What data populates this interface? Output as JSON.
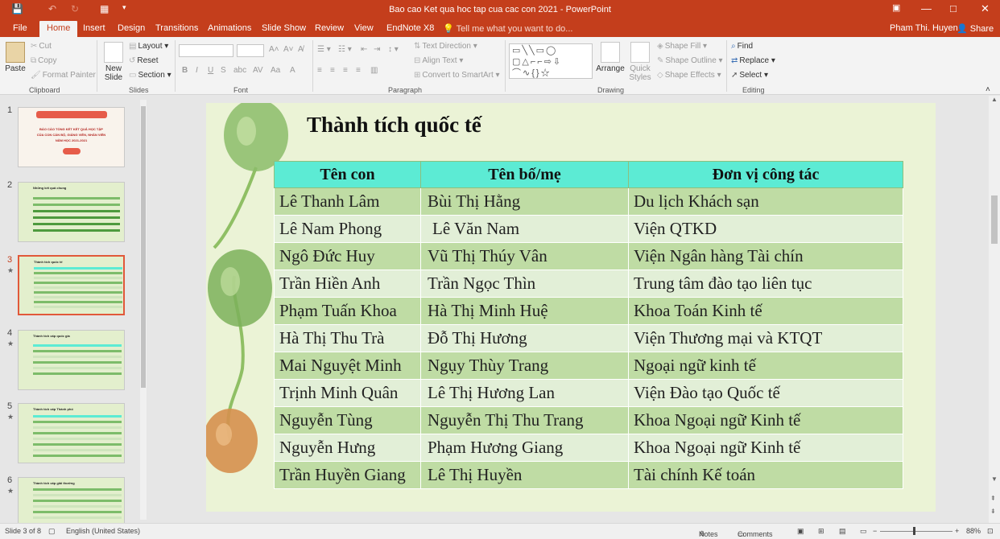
{
  "window": {
    "title": "Bao cao Ket qua hoc tap cua cac con 2021 - PowerPoint",
    "user": "Pham Thi. Huyen",
    "share": "Share"
  },
  "tabs": [
    "File",
    "Home",
    "Insert",
    "Design",
    "Transitions",
    "Animations",
    "Slide Show",
    "Review",
    "View",
    "EndNote X8"
  ],
  "tellme": "Tell me what you want to do...",
  "ribbon": {
    "clipboard": {
      "paste": "Paste",
      "cut": "Cut",
      "copy": "Copy",
      "format_painter": "Format Painter",
      "label": "Clipboard"
    },
    "slides": {
      "new_slide": "New Slide",
      "layout": "Layout",
      "reset": "Reset",
      "section": "Section",
      "label": "Slides"
    },
    "font": {
      "label": "Font"
    },
    "paragraph": {
      "text_direction": "Text Direction",
      "align_text": "Align Text",
      "smartart": "Convert to SmartArt",
      "label": "Paragraph"
    },
    "drawing": {
      "arrange": "Arrange",
      "quick_styles": "Quick Styles",
      "shape_fill": "Shape Fill",
      "shape_outline": "Shape Outline",
      "shape_effects": "Shape Effects",
      "label": "Drawing"
    },
    "editing": {
      "find": "Find",
      "replace": "Replace",
      "select": "Select",
      "label": "Editing"
    }
  },
  "thumbnails": [
    {
      "num": "1",
      "lines": [
        "BÁO CÁO TỔNG KẾT KẾT QUẢ HỌC TẬP",
        "CỦA CON CÁN BỘ, GIẢNG VIÊN, NHÂN VIÊN",
        "NĂM HỌC 2021-2021"
      ]
    },
    {
      "num": "2",
      "title": "Những kết quả chung"
    },
    {
      "num": "3",
      "title": "Thành tích quốc tế"
    },
    {
      "num": "4",
      "title": "Thành tích cấp quốc gia"
    },
    {
      "num": "5",
      "title": "Thành tích cấp Thành phố"
    },
    {
      "num": "6",
      "title": "Thành tích cấp giải thưởng"
    }
  ],
  "slide": {
    "title": "Thành tích quốc tế",
    "headers": [
      "Tên con",
      "Tên bố/mẹ",
      "Đơn vị công tác"
    ],
    "rows": [
      [
        "Lê Thanh Lâm",
        "Bùi Thị Hằng",
        "Du lịch Khách sạn"
      ],
      [
        "Lê Nam Phong",
        "Lê Văn Nam",
        "Viện QTKD"
      ],
      [
        "Ngô Đức Huy",
        "Vũ Thị Thúy Vân",
        "Viện Ngân hàng Tài chín"
      ],
      [
        "Trần Hiền Anh",
        "Trần Ngọc Thìn",
        "Trung tâm đào tạo liên tục"
      ],
      [
        "Phạm Tuấn Khoa",
        "Hà Thị Minh Huệ",
        "Khoa Toán Kinh tế"
      ],
      [
        "Hà Thị Thu Trà",
        "Đỗ Thị Hương",
        "Viện Thương mại và KTQT"
      ],
      [
        "Mai Nguyệt Minh",
        "Ngụy Thùy Trang",
        "Ngoại ngữ kinh tế"
      ],
      [
        "Trịnh Minh Quân",
        "Lê Thị Hương Lan",
        "Viện Đào tạo Quốc tế"
      ],
      [
        "Nguyễn Tùng",
        "Nguyễn Thị Thu Trang",
        "Khoa Ngoại ngữ Kinh tế"
      ],
      [
        "Nguyễn Hưng",
        "Phạm Hương Giang",
        "Khoa Ngoại ngữ Kinh tế"
      ],
      [
        "Trần Huyền Giang",
        "Lê Thị Huyền",
        "Tài chính Kế toán"
      ]
    ]
  },
  "status": {
    "slide_info": "Slide 3 of 8",
    "language": "English (United States)",
    "notes": "Notes",
    "comments": "Comments",
    "zoom": "88%"
  },
  "colors": {
    "accent": "#c43e1c",
    "table_header": "#5cebd4",
    "row_dark": "#bfdca4",
    "row_light": "#e2efd7"
  }
}
